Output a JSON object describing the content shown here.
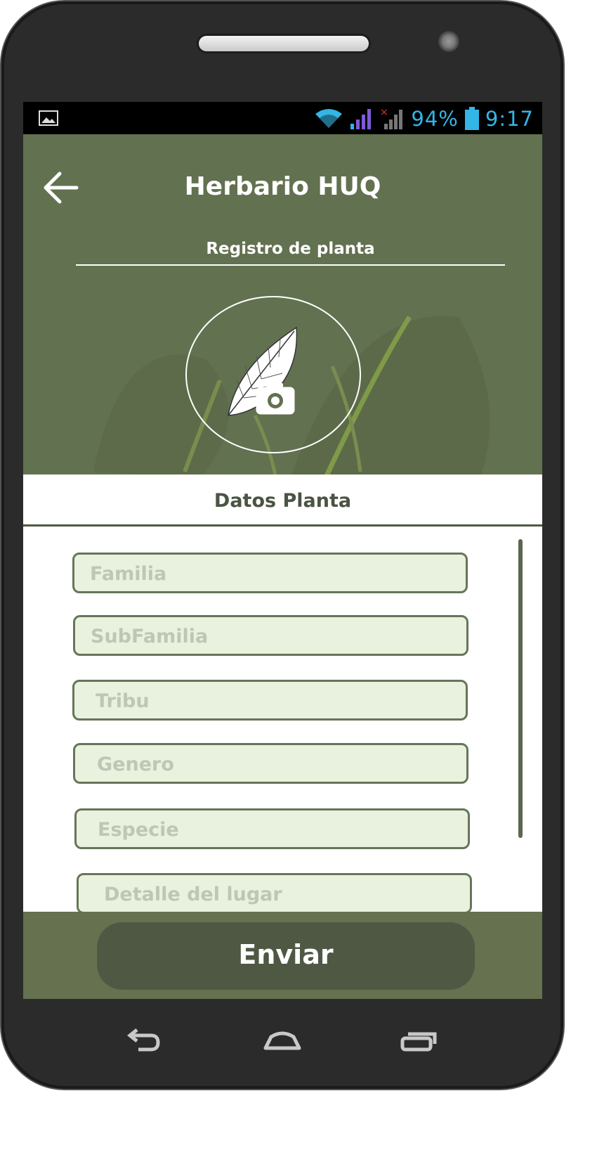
{
  "status_bar": {
    "battery": "94%",
    "time": "9:17",
    "colors": {
      "icons": "#33b5e5",
      "signal_accent": "#7b5cd6"
    }
  },
  "header": {
    "app_title": "Herbario HUQ",
    "subtitle": "Registro de planta",
    "background_color": "#627150"
  },
  "section": {
    "title": "Datos Planta"
  },
  "form": {
    "fields": [
      {
        "placeholder": "Familia"
      },
      {
        "placeholder": "SubFamilia"
      },
      {
        "placeholder": "Tribu"
      },
      {
        "placeholder": "Genero"
      },
      {
        "placeholder": "Especie"
      },
      {
        "placeholder": "Detalle del lugar"
      }
    ],
    "field_background": "#e8f2de",
    "field_border": "#677559"
  },
  "footer": {
    "submit_label": "Enviar"
  },
  "icons": {
    "back": "arrow-left-icon",
    "photo": "leaf-camera-icon",
    "nav_back": "back-icon",
    "nav_home": "home-icon",
    "nav_recent": "recent-apps-icon"
  }
}
